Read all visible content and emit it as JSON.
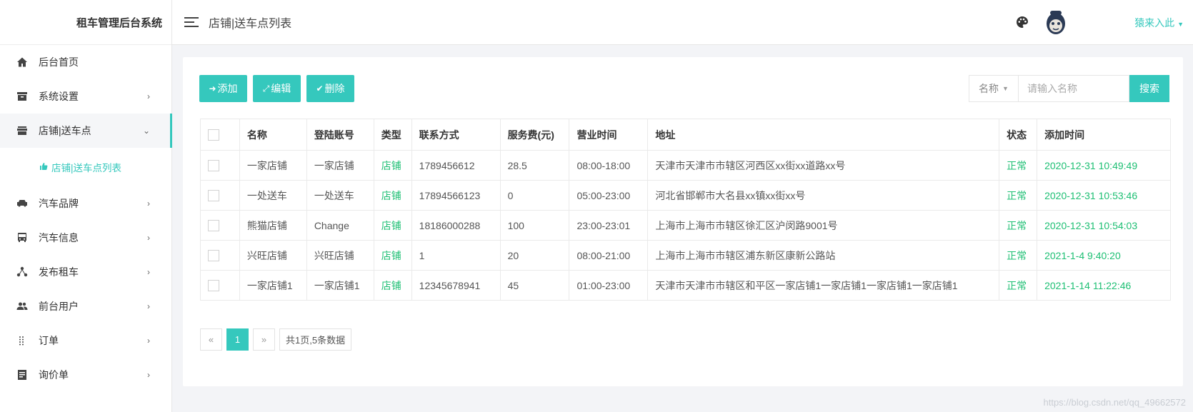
{
  "sidebar": {
    "brand": "租车管理后台系统",
    "items": [
      {
        "label": "后台首页",
        "icon": "home-icon"
      },
      {
        "label": "系统设置",
        "icon": "archive-icon"
      },
      {
        "label": "店铺|送车点",
        "icon": "store-icon"
      },
      {
        "label": "汽车品牌",
        "icon": "car-icon"
      },
      {
        "label": "汽车信息",
        "icon": "bus-icon"
      },
      {
        "label": "发布租车",
        "icon": "share-icon"
      },
      {
        "label": "前台用户",
        "icon": "users-icon"
      },
      {
        "label": "订单",
        "icon": "grid-dots-icon"
      },
      {
        "label": "询价单",
        "icon": "list-icon"
      }
    ],
    "sub_item": {
      "label": "店铺|送车点列表",
      "icon": "thumbs-up-icon"
    }
  },
  "header": {
    "title": "店铺|送车点列表",
    "user": "猿来入此"
  },
  "toolbar": {
    "add": "添加",
    "edit": "编辑",
    "delete": "删除"
  },
  "search": {
    "field": "名称",
    "placeholder": "请输入名称",
    "button": "搜索"
  },
  "table": {
    "headers": [
      "名称",
      "登陆账号",
      "类型",
      "联系方式",
      "服务费(元)",
      "营业时间",
      "地址",
      "状态",
      "添加时间"
    ],
    "rows": [
      [
        "一家店铺",
        "一家店铺",
        "店铺",
        "1789456612",
        "28.5",
        "08:00-18:00",
        "天津市天津市市辖区河西区xx街xx道路xx号",
        "正常",
        "2020-12-31 10:49:49"
      ],
      [
        "一处送车",
        "一处送车",
        "店铺",
        "17894566123",
        "0",
        "05:00-23:00",
        "河北省邯郸市大名县xx镇xx街xx号",
        "正常",
        "2020-12-31 10:53:46"
      ],
      [
        "熊猫店铺",
        "Change",
        "店铺",
        "18186000288",
        "100",
        "23:00-23:01",
        "上海市上海市市辖区徐汇区沪闵路9001号",
        "正常",
        "2020-12-31 10:54:03"
      ],
      [
        "兴旺店铺",
        "兴旺店铺",
        "店铺",
        "1",
        "20",
        "08:00-21:00",
        "上海市上海市市辖区浦东新区康新公路站",
        "正常",
        "2021-1-4 9:40:20"
      ],
      [
        "一家店铺1",
        "一家店铺1",
        "店铺",
        "12345678941",
        "45",
        "01:00-23:00",
        "天津市天津市市辖区和平区一家店铺1一家店铺1一家店铺1一家店铺1",
        "正常",
        "2021-1-14 11:22:46"
      ]
    ]
  },
  "pager": {
    "prev": "«",
    "current": "1",
    "next": "»",
    "info": "共1页,5条数据"
  },
  "watermark": "https://blog.csdn.net/qq_49662572",
  "colors": {
    "accent": "#35c8bd",
    "status_green": "#1dbf73"
  }
}
